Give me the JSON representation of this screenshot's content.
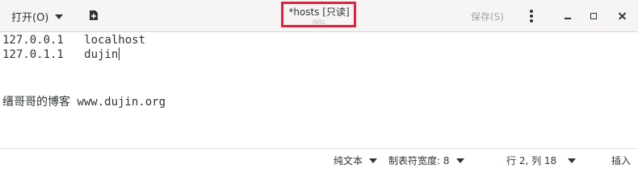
{
  "toolbar": {
    "open_label": "打开(O)",
    "save_label": "保存(S)"
  },
  "window": {
    "title": "*hosts [只读]",
    "subtitle": "/etc"
  },
  "editor": {
    "line1": "127.0.0.1   localhost",
    "line2": "127.0.1.1   dujin",
    "line5_cjk": "缙哥哥的博客",
    "line5_rest": " www.dujin.org"
  },
  "statusbar": {
    "language": "纯文本",
    "tab_width": "制表符宽度: 8",
    "position": "行 2, 列 18",
    "mode": "插入"
  },
  "colors": {
    "highlight_border": "#e0223f",
    "header_bg": "#f6f5f4",
    "disabled_text": "#a3a3a3"
  }
}
